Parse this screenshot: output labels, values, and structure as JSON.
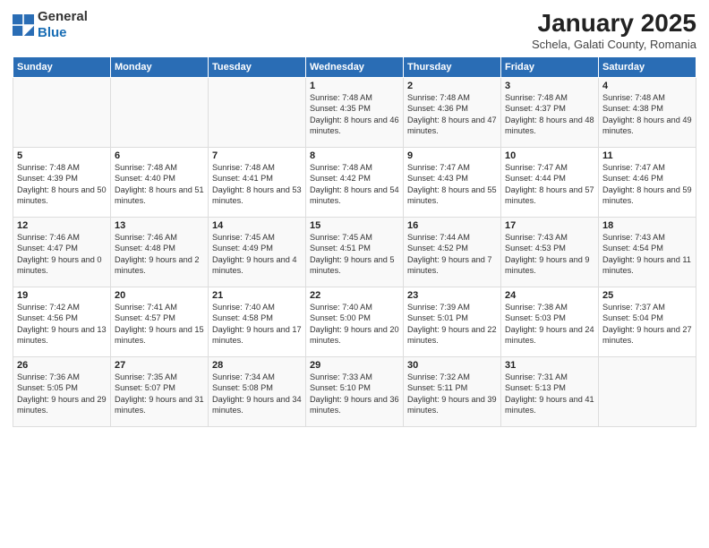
{
  "header": {
    "logo_general": "General",
    "logo_blue": "Blue",
    "title": "January 2025",
    "subtitle": "Schela, Galati County, Romania"
  },
  "days_of_week": [
    "Sunday",
    "Monday",
    "Tuesday",
    "Wednesday",
    "Thursday",
    "Friday",
    "Saturday"
  ],
  "weeks": [
    [
      {
        "day": "",
        "info": ""
      },
      {
        "day": "",
        "info": ""
      },
      {
        "day": "",
        "info": ""
      },
      {
        "day": "1",
        "info": "Sunrise: 7:48 AM\nSunset: 4:35 PM\nDaylight: 8 hours and 46 minutes."
      },
      {
        "day": "2",
        "info": "Sunrise: 7:48 AM\nSunset: 4:36 PM\nDaylight: 8 hours and 47 minutes."
      },
      {
        "day": "3",
        "info": "Sunrise: 7:48 AM\nSunset: 4:37 PM\nDaylight: 8 hours and 48 minutes."
      },
      {
        "day": "4",
        "info": "Sunrise: 7:48 AM\nSunset: 4:38 PM\nDaylight: 8 hours and 49 minutes."
      }
    ],
    [
      {
        "day": "5",
        "info": "Sunrise: 7:48 AM\nSunset: 4:39 PM\nDaylight: 8 hours and 50 minutes."
      },
      {
        "day": "6",
        "info": "Sunrise: 7:48 AM\nSunset: 4:40 PM\nDaylight: 8 hours and 51 minutes."
      },
      {
        "day": "7",
        "info": "Sunrise: 7:48 AM\nSunset: 4:41 PM\nDaylight: 8 hours and 53 minutes."
      },
      {
        "day": "8",
        "info": "Sunrise: 7:48 AM\nSunset: 4:42 PM\nDaylight: 8 hours and 54 minutes."
      },
      {
        "day": "9",
        "info": "Sunrise: 7:47 AM\nSunset: 4:43 PM\nDaylight: 8 hours and 55 minutes."
      },
      {
        "day": "10",
        "info": "Sunrise: 7:47 AM\nSunset: 4:44 PM\nDaylight: 8 hours and 57 minutes."
      },
      {
        "day": "11",
        "info": "Sunrise: 7:47 AM\nSunset: 4:46 PM\nDaylight: 8 hours and 59 minutes."
      }
    ],
    [
      {
        "day": "12",
        "info": "Sunrise: 7:46 AM\nSunset: 4:47 PM\nDaylight: 9 hours and 0 minutes."
      },
      {
        "day": "13",
        "info": "Sunrise: 7:46 AM\nSunset: 4:48 PM\nDaylight: 9 hours and 2 minutes."
      },
      {
        "day": "14",
        "info": "Sunrise: 7:45 AM\nSunset: 4:49 PM\nDaylight: 9 hours and 4 minutes."
      },
      {
        "day": "15",
        "info": "Sunrise: 7:45 AM\nSunset: 4:51 PM\nDaylight: 9 hours and 5 minutes."
      },
      {
        "day": "16",
        "info": "Sunrise: 7:44 AM\nSunset: 4:52 PM\nDaylight: 9 hours and 7 minutes."
      },
      {
        "day": "17",
        "info": "Sunrise: 7:43 AM\nSunset: 4:53 PM\nDaylight: 9 hours and 9 minutes."
      },
      {
        "day": "18",
        "info": "Sunrise: 7:43 AM\nSunset: 4:54 PM\nDaylight: 9 hours and 11 minutes."
      }
    ],
    [
      {
        "day": "19",
        "info": "Sunrise: 7:42 AM\nSunset: 4:56 PM\nDaylight: 9 hours and 13 minutes."
      },
      {
        "day": "20",
        "info": "Sunrise: 7:41 AM\nSunset: 4:57 PM\nDaylight: 9 hours and 15 minutes."
      },
      {
        "day": "21",
        "info": "Sunrise: 7:40 AM\nSunset: 4:58 PM\nDaylight: 9 hours and 17 minutes."
      },
      {
        "day": "22",
        "info": "Sunrise: 7:40 AM\nSunset: 5:00 PM\nDaylight: 9 hours and 20 minutes."
      },
      {
        "day": "23",
        "info": "Sunrise: 7:39 AM\nSunset: 5:01 PM\nDaylight: 9 hours and 22 minutes."
      },
      {
        "day": "24",
        "info": "Sunrise: 7:38 AM\nSunset: 5:03 PM\nDaylight: 9 hours and 24 minutes."
      },
      {
        "day": "25",
        "info": "Sunrise: 7:37 AM\nSunset: 5:04 PM\nDaylight: 9 hours and 27 minutes."
      }
    ],
    [
      {
        "day": "26",
        "info": "Sunrise: 7:36 AM\nSunset: 5:05 PM\nDaylight: 9 hours and 29 minutes."
      },
      {
        "day": "27",
        "info": "Sunrise: 7:35 AM\nSunset: 5:07 PM\nDaylight: 9 hours and 31 minutes."
      },
      {
        "day": "28",
        "info": "Sunrise: 7:34 AM\nSunset: 5:08 PM\nDaylight: 9 hours and 34 minutes."
      },
      {
        "day": "29",
        "info": "Sunrise: 7:33 AM\nSunset: 5:10 PM\nDaylight: 9 hours and 36 minutes."
      },
      {
        "day": "30",
        "info": "Sunrise: 7:32 AM\nSunset: 5:11 PM\nDaylight: 9 hours and 39 minutes."
      },
      {
        "day": "31",
        "info": "Sunrise: 7:31 AM\nSunset: 5:13 PM\nDaylight: 9 hours and 41 minutes."
      },
      {
        "day": "",
        "info": ""
      }
    ]
  ]
}
